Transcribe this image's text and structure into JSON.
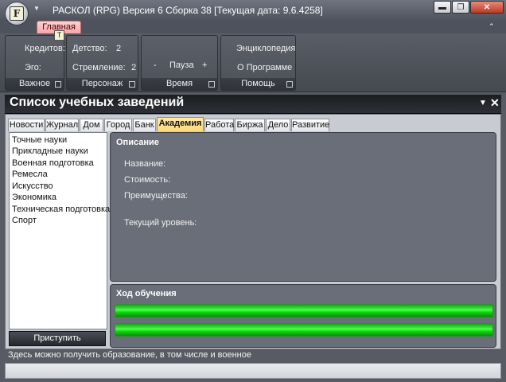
{
  "window": {
    "title": "РАСКОЛ (RPG) Версия 6 Сборка 38 [Текущая дата: 9.6.4258]",
    "app_icon_letter": "F",
    "quick_access_icon": "dropdown-arrow-icon",
    "min_glyph": "▬",
    "max_glyph": "❐",
    "close_glyph": "✕"
  },
  "ribbon": {
    "tab_label": "Главная",
    "keytip": "T",
    "collapse_glyph": "⌃",
    "groups": [
      {
        "label": "Важное",
        "items": [
          "Кредитов:",
          "Эго:"
        ]
      },
      {
        "label": "Персонаж",
        "items": [
          "Детство:",
          "2",
          "Стремление:",
          "2"
        ]
      },
      {
        "label": "Время",
        "items": [
          "-",
          "Пауза",
          "+"
        ]
      },
      {
        "label": "Помощь",
        "items": [
          "Энциклопедия",
          "О Программе"
        ]
      }
    ]
  },
  "document": {
    "title": "Список учебных заведений",
    "pin_glyph": "▼",
    "close_glyph": "✕"
  },
  "tabs": [
    "Новости",
    "Журнал",
    "Дом",
    "Город",
    "Банк",
    "Академия",
    "Работа",
    "Биржа",
    "Дело",
    "Развитие"
  ],
  "active_tab": "Академия",
  "schools": [
    "Точные науки",
    "Прикладные науки",
    "Военная подготовка",
    "Ремесла",
    "Искусство",
    "Экономика",
    "Техническая подготовка",
    "Спорт"
  ],
  "start_button": "Приступить",
  "description": {
    "title": "Описание",
    "name_label": "Название:",
    "cost_label": "Стоимость:",
    "advantages_label": "Преимущества:",
    "level_label": "Текущий уровень:"
  },
  "progress": {
    "title": "Ход обучения",
    "bar1": 1.0,
    "bar2": 1.0,
    "color": "#1ee01e"
  },
  "status": "Здесь можно получить образование, в том числе и военное"
}
